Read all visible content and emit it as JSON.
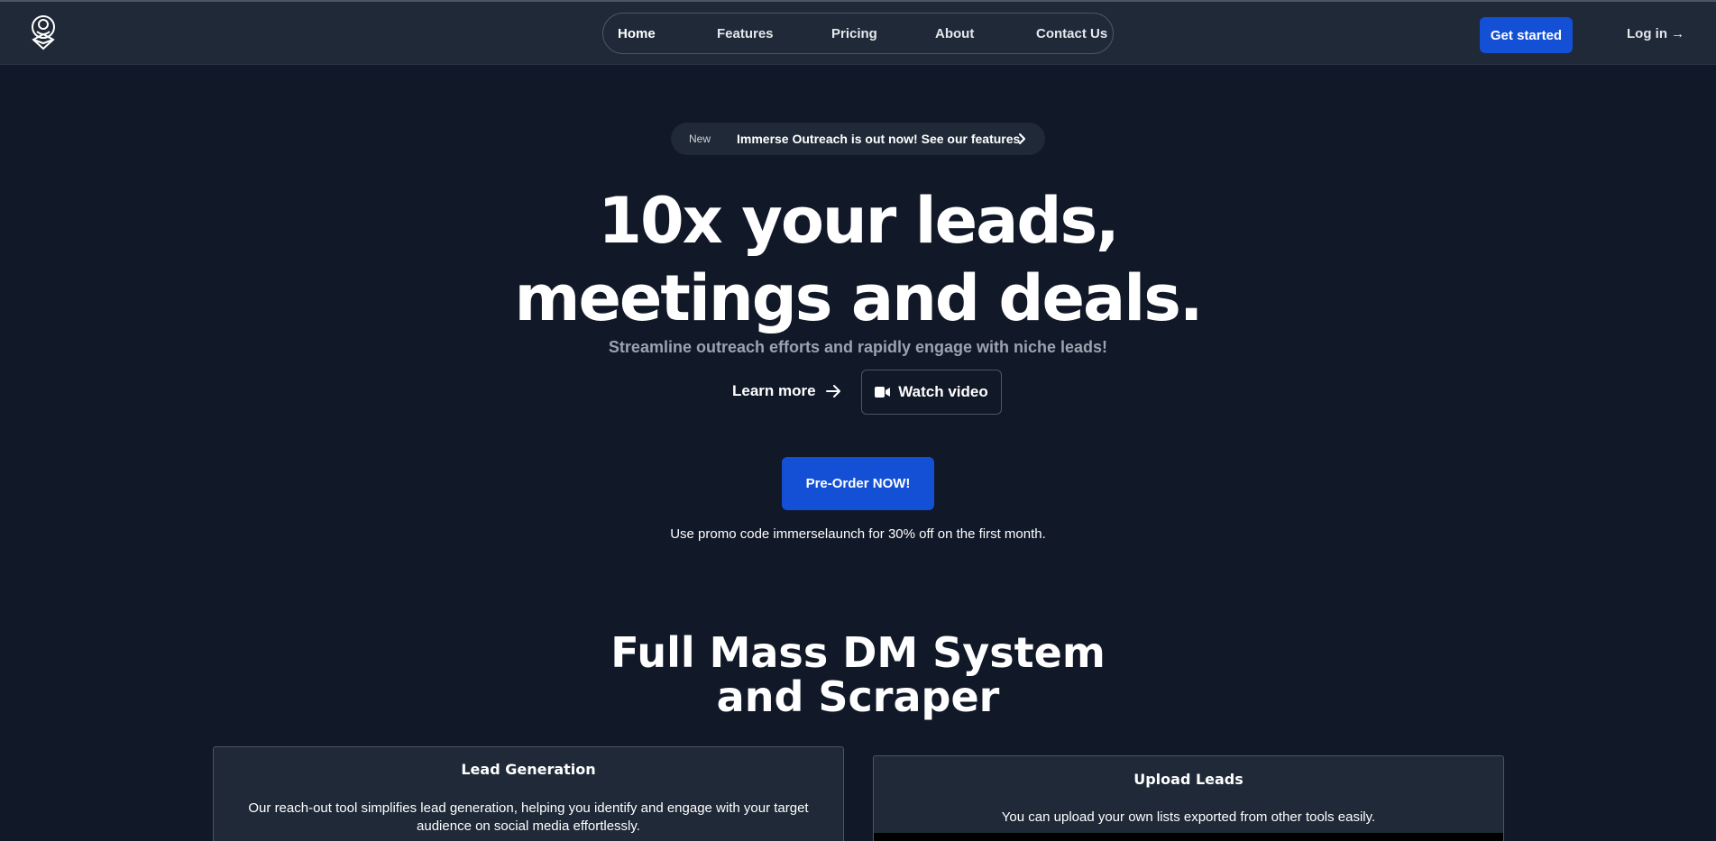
{
  "header": {
    "nav": [
      {
        "label": "Home",
        "active": true
      },
      {
        "label": "Features",
        "active": false
      },
      {
        "label": "Pricing",
        "active": false
      },
      {
        "label": "About",
        "active": false
      },
      {
        "label": "Contact Us",
        "active": false
      }
    ],
    "get_started_label": "Get started",
    "login_label": "Log in →"
  },
  "announcement": {
    "tag": "New",
    "message": "Immerse Outreach is out now! See our features"
  },
  "hero": {
    "title_line1": "10x your leads,",
    "title_line2": "meetings and deals.",
    "subtitle": "Streamline outreach efforts and rapidly engage with niche leads!",
    "learn_more_label": "Learn more",
    "watch_video_label": "Watch video",
    "preorder_label": "Pre-Order NOW!",
    "promo_text": "Use promo code immerselaunch for 30% off on the first month."
  },
  "features": {
    "title_line1": "Full Mass DM System",
    "title_line2": "and Scraper",
    "cards": [
      {
        "title": "Lead Generation",
        "text": "Our reach-out tool simplifies lead generation, helping you identify and engage with your target audience on social media effortlessly."
      },
      {
        "title": "Upload Leads",
        "text": "You can upload your own lists exported from other tools easily."
      }
    ]
  },
  "colors": {
    "background": "#111827",
    "header_background": "#1f2937",
    "accent": "#1450d6",
    "muted_text": "#9ca3af"
  },
  "icons": [
    "logo-icon",
    "chevron-right-icon",
    "arrow-right-icon",
    "video-camera-icon"
  ]
}
